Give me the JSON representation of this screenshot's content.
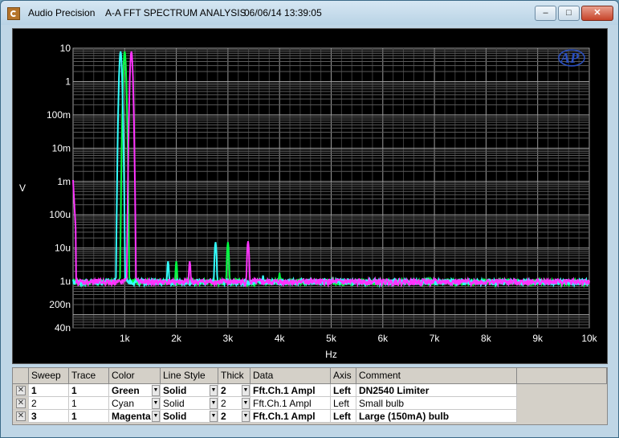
{
  "window": {
    "app_name": "Audio Precision",
    "doc_title": "A-A FFT SPECTRUM ANALYSIS",
    "timestamp": "06/06/14 13:39:05",
    "minimize_glyph": "–",
    "maximize_glyph": "□",
    "close_glyph": "✕"
  },
  "logo_text": "AP",
  "chart_data": {
    "type": "line",
    "title": "",
    "xlabel": "Hz",
    "ylabel": "V",
    "xlim": [
      0,
      10000
    ],
    "ylim": [
      4e-08,
      10
    ],
    "y_scale": "log",
    "x_ticks": [
      {
        "v": 1000,
        "label": "1k"
      },
      {
        "v": 2000,
        "label": "2k"
      },
      {
        "v": 3000,
        "label": "3k"
      },
      {
        "v": 4000,
        "label": "4k"
      },
      {
        "v": 5000,
        "label": "5k"
      },
      {
        "v": 6000,
        "label": "6k"
      },
      {
        "v": 7000,
        "label": "7k"
      },
      {
        "v": 8000,
        "label": "8k"
      },
      {
        "v": 9000,
        "label": "9k"
      },
      {
        "v": 10000,
        "label": "10k"
      }
    ],
    "y_ticks": [
      {
        "v": 10,
        "label": "10"
      },
      {
        "v": 1,
        "label": "1"
      },
      {
        "v": 0.1,
        "label": "100m"
      },
      {
        "v": 0.01,
        "label": "10m"
      },
      {
        "v": 0.001,
        "label": "1m"
      },
      {
        "v": 0.0001,
        "label": "100u"
      },
      {
        "v": 1e-05,
        "label": "10u"
      },
      {
        "v": 1e-06,
        "label": "1u"
      },
      {
        "v": 2e-07,
        "label": "200n"
      },
      {
        "v": 4e-08,
        "label": "40n"
      }
    ],
    "grid": true,
    "series": [
      {
        "color": "#00ff40",
        "noise_floor": 9e-07,
        "peaks": [
          {
            "x": 1000,
            "y": 8,
            "width": 45
          },
          {
            "x": 2000,
            "y": 4e-06,
            "width": 40
          },
          {
            "x": 3000,
            "y": 1.5e-05,
            "width": 40
          },
          {
            "x": 4000,
            "y": 1.8e-06,
            "width": 40
          },
          {
            "x": 5000,
            "y": 1.1e-06,
            "width": 30
          },
          {
            "x": 6000,
            "y": 1.1e-06,
            "width": 30
          }
        ]
      },
      {
        "color": "#33ffff",
        "noise_floor": 9e-07,
        "peaks": [
          {
            "x": 920,
            "y": 8,
            "width": 45
          },
          {
            "x": 1840,
            "y": 4e-06,
            "width": 40
          },
          {
            "x": 2760,
            "y": 1.5e-05,
            "width": 40
          },
          {
            "x": 3680,
            "y": 1.5e-06,
            "width": 40
          },
          {
            "x": 4600,
            "y": 1.2e-06,
            "width": 30
          },
          {
            "x": 5520,
            "y": 1.1e-06,
            "width": 30
          }
        ]
      },
      {
        "color": "#ff33ff",
        "noise_floor": 9e-07,
        "start_value": 0.0011,
        "peaks": [
          {
            "x": 1130,
            "y": 8,
            "width": 45
          },
          {
            "x": 2260,
            "y": 4e-06,
            "width": 40
          },
          {
            "x": 3390,
            "y": 1.6e-05,
            "width": 40
          },
          {
            "x": 4520,
            "y": 1.2e-06,
            "width": 40
          },
          {
            "x": 5650,
            "y": 1.1e-06,
            "width": 30
          },
          {
            "x": 6780,
            "y": 1.1e-06,
            "width": 30
          }
        ]
      }
    ]
  },
  "sweep_table": {
    "headers": [
      "Sweep",
      "Trace",
      "Color",
      "Line Style",
      "Thick",
      "Data",
      "Axis",
      "Comment"
    ],
    "rows": [
      {
        "checked": true,
        "sweep": "1",
        "trace": "1",
        "color": "Green",
        "line_style": "Solid",
        "thick": "2",
        "data": "Fft.Ch.1 Ampl",
        "axis": "Left",
        "comment": "DN2540 Limiter",
        "bold": true
      },
      {
        "checked": true,
        "sweep": "2",
        "trace": "1",
        "color": "Cyan",
        "line_style": "Solid",
        "thick": "2",
        "data": "Fft.Ch.1 Ampl",
        "axis": "Left",
        "comment": "Small bulb",
        "bold": false
      },
      {
        "checked": true,
        "sweep": "3",
        "trace": "1",
        "color": "Magenta",
        "line_style": "Solid",
        "thick": "2",
        "data": "Fft.Ch.1 Ampl",
        "axis": "Left",
        "comment": "Large (150mA) bulb",
        "bold": true
      }
    ],
    "check_glyph": "✕",
    "dropdown_glyph": "▼"
  }
}
